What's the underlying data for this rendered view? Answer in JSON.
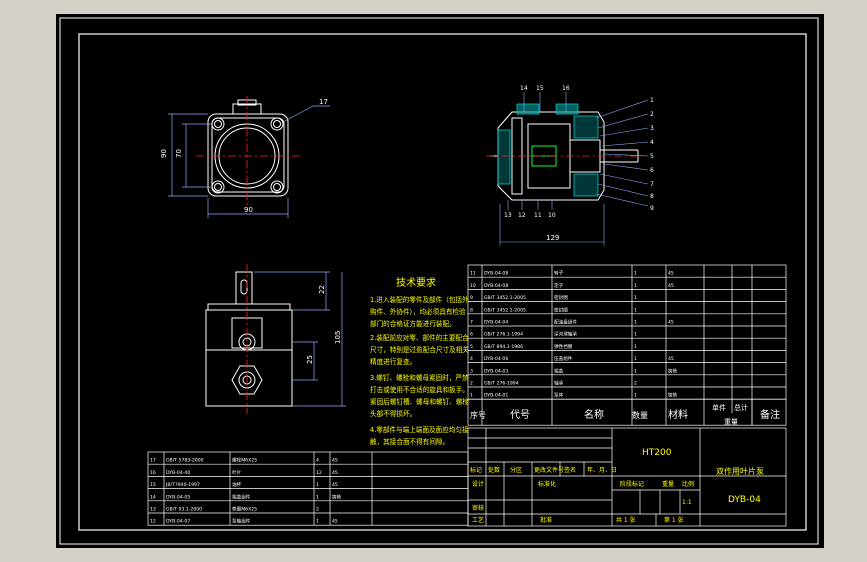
{
  "colors": {
    "chrome": "#d4d0c8",
    "paper": "#000000",
    "frame": "#ffffff",
    "line": "#ffffff",
    "center": "#ff2020",
    "dim": "#8fa8ff",
    "note": "#ffff00",
    "label": "#ffffff",
    "hatch": "#00c8c8",
    "green": "#00ff40"
  },
  "tech_req": {
    "title": "技术要求",
    "lines": [
      "1.进入装配的零件及部件（包括外",
      "购件、外协件），均必须具有检验",
      "部门的合格证方能进行装配。",
      "2.装配前应对零、部件的主要配合",
      "尺寸，特别是过盈配合尺寸及相关",
      "精度进行复查。",
      "3.螺钉、螺栓和螺母紧固时，严禁",
      "打击或使用不合适的旋具和扳手。",
      "紧固后螺钉槽、螺母和螺钉、螺栓",
      "头部不得损坏。",
      "4.零部件与端上端面及面应均匀接",
      "触，其接合面不得有间隙。"
    ]
  },
  "dims": {
    "front_width": "90",
    "front_height_outer": "90",
    "front_height_inner": "70",
    "side_length": "129",
    "top_height_a": "22",
    "top_height_b": "25",
    "top_height_total": "105"
  },
  "callouts": {
    "front": "17",
    "section_top": [
      "14",
      "15",
      "16"
    ],
    "section_right": [
      "1",
      "2",
      "3",
      "4",
      "5",
      "6",
      "7",
      "8",
      "9"
    ],
    "section_bottom": [
      "13",
      "12",
      "11",
      "10"
    ]
  },
  "bom_right": {
    "rows": [
      [
        "11",
        "DYB-04-08",
        "转子",
        "1",
        "45",
        ""
      ],
      [
        "10",
        "DYB-04-08",
        "定子",
        "1",
        "45",
        ""
      ],
      [
        "9",
        "GB/T 3452.1-2005",
        "密封圈",
        "1",
        "",
        ""
      ],
      [
        "8",
        "GB/T 3452.1-2005",
        "密封圈",
        "1",
        "",
        ""
      ],
      [
        "7",
        "DYB-04-04",
        "配油盘组件",
        "1",
        "45",
        ""
      ],
      [
        "6",
        "GB/T 276.1-1994",
        "深沟球轴承",
        "1",
        "",
        ""
      ],
      [
        "5",
        "GB/T 894.1-1986",
        "弹性挡圈",
        "1",
        "",
        ""
      ],
      [
        "4",
        "DYB-04-06",
        "压盖组件",
        "1",
        "45",
        ""
      ],
      [
        "3",
        "DYB-04-03",
        "端盖",
        "1",
        "铸铁",
        ""
      ],
      [
        "2",
        "GB/T 276-1994",
        "轴承",
        "2",
        "",
        ""
      ],
      [
        "1",
        "DYB-04-01",
        "泵体",
        "1",
        "铸铁",
        ""
      ]
    ],
    "header": [
      "序号",
      "代号",
      "名称",
      "数量",
      "材料",
      "单件",
      "总计",
      "备注"
    ],
    "header_sub": "重量"
  },
  "bom_left": {
    "rows": [
      [
        "17",
        "GB/T 5783-2000",
        "螺栓M6X25",
        "4",
        "45",
        ""
      ],
      [
        "16",
        "DYB-04-40",
        "叶片",
        "12",
        "45",
        ""
      ],
      [
        "15",
        "JB/T7940-1997",
        "油杯",
        "1",
        "45",
        ""
      ],
      [
        "14",
        "DYB-04-05",
        "端盖组件",
        "1",
        "铸铁",
        ""
      ],
      [
        "13",
        "GB/T 93.1-2000",
        "垫圈M6X25",
        "2",
        "",
        ""
      ],
      [
        "12",
        "DYB-04-07",
        "泵轴组件",
        "1",
        "45",
        ""
      ]
    ]
  },
  "title_block": {
    "material": "HT200",
    "name": "双作用叶片泵",
    "code": "DYB-04",
    "row_labels": [
      "标记",
      "处数",
      "分区",
      "更改文件号",
      "签名",
      "年、月、日"
    ],
    "design": "设计",
    "standard": "标准化",
    "stage": "阶段标记",
    "weight": "重量",
    "scale": "比例",
    "scale_val": "1:1",
    "check": "审核",
    "craft": "工艺",
    "approve": "批准",
    "sheets": "共 1 张",
    "sheet": "第 1 张"
  }
}
